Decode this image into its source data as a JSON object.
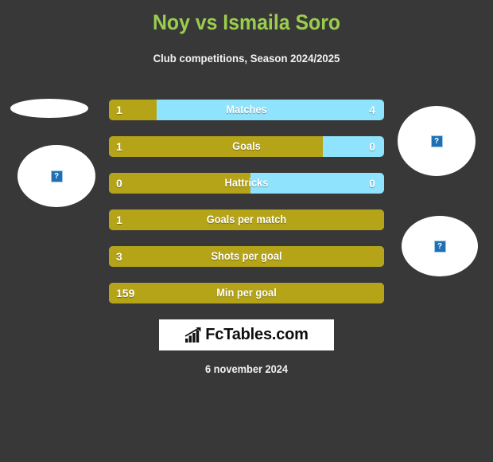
{
  "header": {
    "title": "Noy vs Ismaila Soro",
    "subtitle": "Club competitions, Season 2024/2025",
    "title_color": "#9acd4e"
  },
  "colors": {
    "background": "#383838",
    "home_bar": "#b6a418",
    "away_bar": "#8fe3fc",
    "text": "#ffffff"
  },
  "logos": {
    "home_flat_alt": "",
    "home_main_alt": "?",
    "away_main_alt": "?",
    "away_second_alt": "?"
  },
  "stats": [
    {
      "label": "Matches",
      "home": "1",
      "away": "4",
      "home_pct": 17.3,
      "split": true
    },
    {
      "label": "Goals",
      "home": "1",
      "away": "0",
      "home_pct": 77.7,
      "split": true
    },
    {
      "label": "Hattricks",
      "home": "0",
      "away": "0",
      "home_pct": 51.5,
      "split": true
    },
    {
      "label": "Goals per match",
      "home": "1",
      "away": "",
      "home_pct": 100,
      "split": false
    },
    {
      "label": "Shots per goal",
      "home": "3",
      "away": "",
      "home_pct": 100,
      "split": false
    },
    {
      "label": "Min per goal",
      "home": "159",
      "away": "",
      "home_pct": 100,
      "split": false
    }
  ],
  "footer": {
    "logo_text": "FcTables.com",
    "date": "6 november 2024"
  }
}
